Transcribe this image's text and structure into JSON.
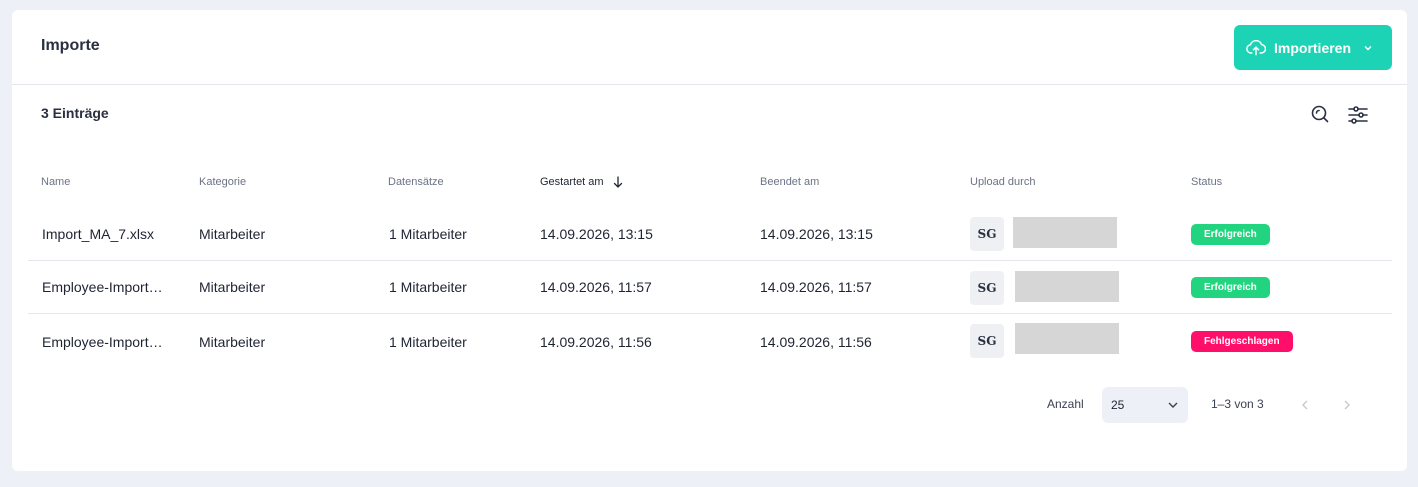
{
  "header": {
    "title": "Importe",
    "import_button": "Importieren"
  },
  "toolbar": {
    "count": "3 Einträge"
  },
  "table": {
    "columns": [
      "Name",
      "Kategorie",
      "Datensätze",
      "Gestartet am",
      "Beendet am",
      "Upload durch",
      "Status"
    ],
    "sorted_column": "Gestartet am",
    "rows": [
      {
        "name": "Import_MA_7.xlsx",
        "kategorie": "Mitarbeiter",
        "datensaetze": "1 Mitarbeiter",
        "gestartet": "14.09.2026, 13:15",
        "beendet": "14.09.2026, 13:15",
        "avatar": "SG",
        "status": "Erfolgreich",
        "status_color": "#22d47f"
      },
      {
        "name": "Employee-Import…",
        "kategorie": "Mitarbeiter",
        "datensaetze": "1 Mitarbeiter",
        "gestartet": "14.09.2026, 11:57",
        "beendet": "14.09.2026, 11:57",
        "avatar": "SG",
        "status": "Erfolgreich",
        "status_color": "#22d47f"
      },
      {
        "name": "Employee-Import…",
        "kategorie": "Mitarbeiter",
        "datensaetze": "1 Mitarbeiter",
        "gestartet": "14.09.2026, 11:56",
        "beendet": "14.09.2026, 11:56",
        "avatar": "SG",
        "status": "Fehlgeschlagen",
        "status_color": "#ff0f6a"
      }
    ]
  },
  "pagination": {
    "label": "Anzahl",
    "per_page": "25",
    "range": "1–3 von 3"
  },
  "colors": {
    "accent": "#1dd3b5",
    "success": "#22d47f",
    "error": "#ff0f6a"
  },
  "icons": {
    "import": "cloud-upload-icon",
    "search": "search-icon",
    "filter": "filter-sliders-icon"
  }
}
